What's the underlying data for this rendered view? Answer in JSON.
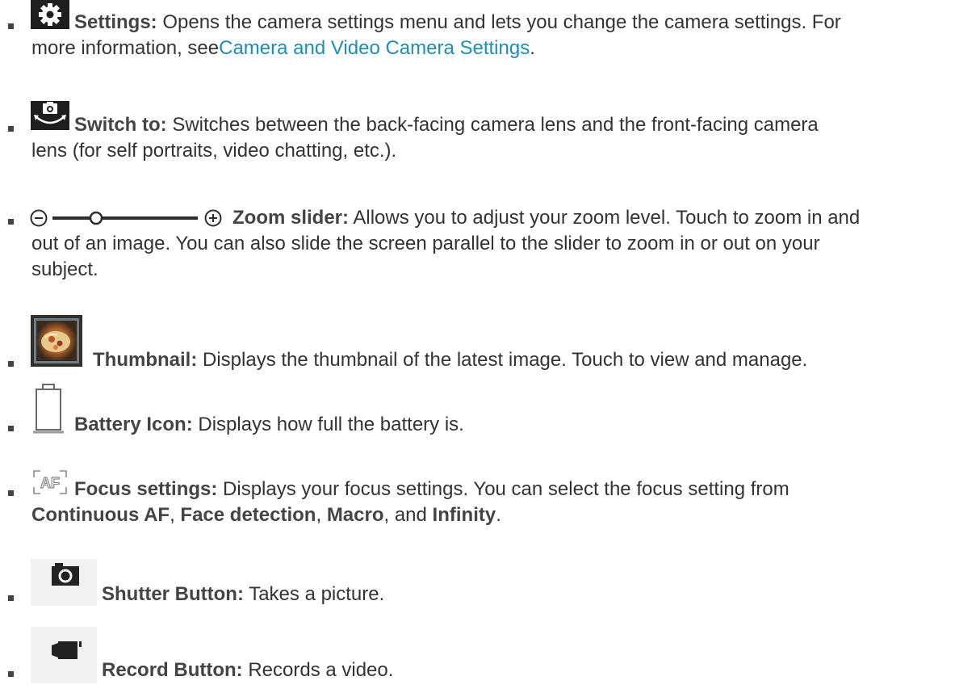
{
  "accent_color": "#1a8fb5",
  "items": [
    {
      "icon": "gear-icon",
      "title": "Settings:",
      "desc_before": " Opens the camera settings menu and lets you change the camera settings. For",
      "desc_line2": "more information, see ",
      "link": "Camera and Video Camera Settings",
      "desc_after": "."
    },
    {
      "icon": "switch-camera-icon",
      "title": "Switch to:",
      "desc_line1": " Switches between the back-facing camera lens and the front-facing camera",
      "desc_line2": "lens (for self portraits, video chatting, etc.)."
    },
    {
      "icon": "zoom-slider-icon",
      "title": "Zoom slider:",
      "desc_line1": " Allows you to adjust your zoom level. Touch to zoom in and",
      "desc_line2": "out of an image. You can also slide the screen parallel to the slider to zoom in or out on your",
      "desc_line3": "subject.",
      "zoom_level": 0.3
    },
    {
      "icon": "thumbnail-image-icon",
      "title": "Thumbnail:",
      "desc_line1": " Displays the thumbnail of the latest image. Touch to view and manage."
    },
    {
      "icon": "battery-icon",
      "title": "Battery Icon:",
      "desc_line1": " Displays how full the battery is."
    },
    {
      "icon": "focus-af-icon",
      "title": "Focus settings:",
      "desc_line1": " Displays your focus settings. You can select the focus setting from",
      "opt1": "Continuous AF",
      "sep1": ", ",
      "opt2": "Face detection",
      "sep2": ", ",
      "opt3": "Macro",
      "sep3": ", and ",
      "opt4": "Infinity",
      "end": "."
    },
    {
      "icon": "camera-icon",
      "title": "Shutter Button:",
      "desc_line1": " Takes a picture."
    },
    {
      "icon": "video-camera-icon",
      "title": "Record Button:",
      "desc_line1": " Records a video."
    }
  ]
}
